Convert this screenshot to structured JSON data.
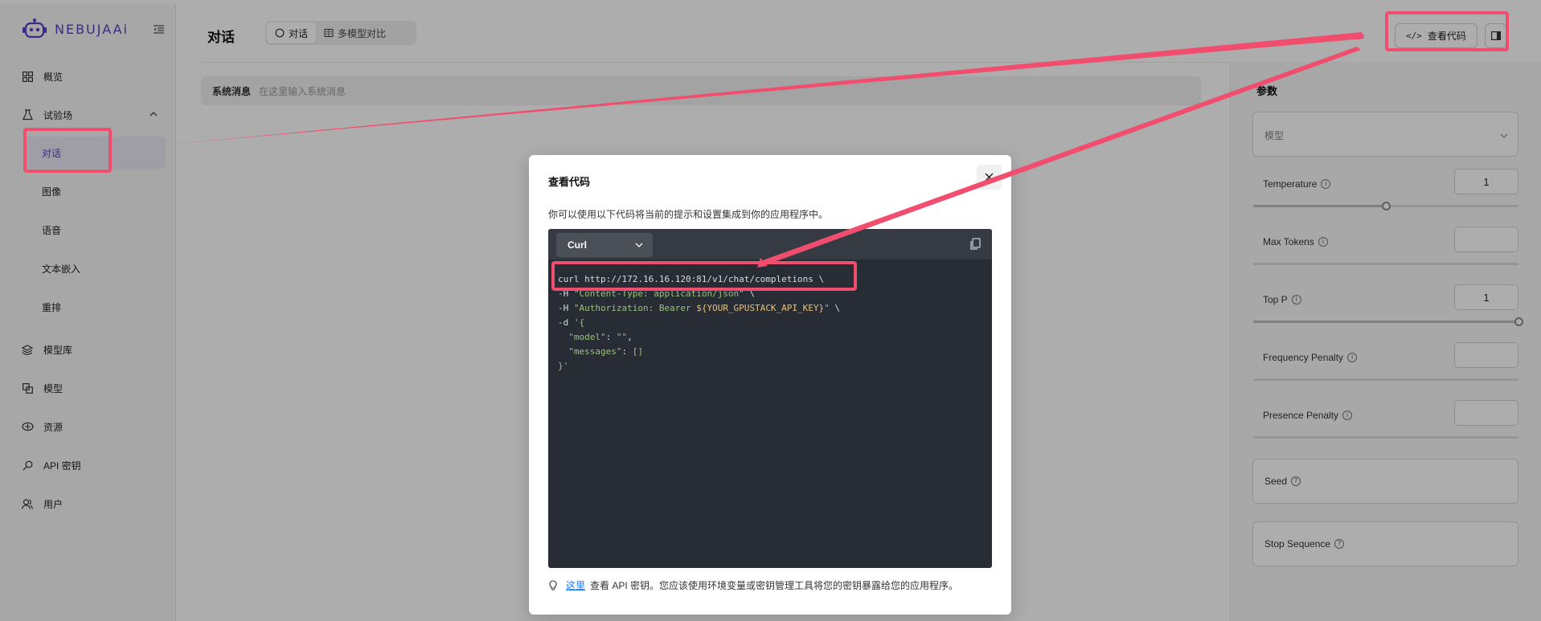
{
  "app": {
    "brand": "NEBUJAAi"
  },
  "sidebar": {
    "items": [
      {
        "label": "概览",
        "icon": "grid-icon"
      },
      {
        "label": "试验场",
        "icon": "flask-icon"
      },
      {
        "label": "模型库",
        "icon": "layers-icon"
      },
      {
        "label": "模型",
        "icon": "model-icon"
      },
      {
        "label": "资源",
        "icon": "cloud-icon"
      },
      {
        "label": "API 密钥",
        "icon": "key-icon"
      },
      {
        "label": "用户",
        "icon": "users-icon"
      }
    ],
    "sub_items": [
      {
        "label": "对话",
        "active": true
      },
      {
        "label": "图像"
      },
      {
        "label": "语音"
      },
      {
        "label": "文本嵌入"
      },
      {
        "label": "重排"
      }
    ]
  },
  "header": {
    "title": "对话",
    "tabs": [
      {
        "label": "对话",
        "active": true
      },
      {
        "label": "多模型对比"
      }
    ],
    "view_code_label": "查看代码"
  },
  "system_message": {
    "label": "系统消息",
    "placeholder": "在这里输入系统消息"
  },
  "params": {
    "title": "参数",
    "model_placeholder": "模型",
    "temperature": {
      "label": "Temperature",
      "value": "1",
      "slider_fraction": 0.5
    },
    "max_tokens": {
      "label": "Max Tokens",
      "value": ""
    },
    "top_p": {
      "label": "Top P",
      "value": "1",
      "slider_fraction": 1.0
    },
    "frequency_penalty": {
      "label": "Frequency Penalty",
      "value": ""
    },
    "presence_penalty": {
      "label": "Presence Penalty",
      "value": ""
    },
    "seed": {
      "label": "Seed"
    },
    "stop_sequence": {
      "label": "Stop Sequence"
    }
  },
  "modal": {
    "title": "查看代码",
    "description": "你可以使用以下代码将当前的提示和设置集成到你的应用程序中。",
    "language": "Curl",
    "code": {
      "line1": "curl http://172.16.16.120:81/v1/chat/completions \\",
      "line2_prefix": "-H ",
      "line2_str": "\"Content-Type: application/json\"",
      "line2_suffix": " \\",
      "line3_prefix": "-H ",
      "line3_str_a": "\"Authorization: Bearer ",
      "line3_var": "${YOUR_GPUSTACK_API_KEY}",
      "line3_str_b": "\"",
      "line3_suffix": " \\",
      "line4_prefix": "-d ",
      "line4_str": "'{",
      "line5_key": "  \"model\"",
      "line5_sep": ": ",
      "line5_val": "\"\"",
      "line5_end": ",",
      "line6_key": "  \"messages\"",
      "line6_sep": ": ",
      "line6_val": "[]",
      "line7": "}'"
    },
    "footer_link": "这里",
    "footer_text": "查看 API 密钥。您应该使用环境变量或密钥管理工具将您的密钥暴露给您的应用程序。"
  },
  "colors": {
    "brand": "#5b3fc4",
    "annotation": "#f14d6e",
    "code_bg": "#282c34",
    "code_string": "#98c379",
    "code_variable": "#e5c07b",
    "link": "#1677ff"
  }
}
